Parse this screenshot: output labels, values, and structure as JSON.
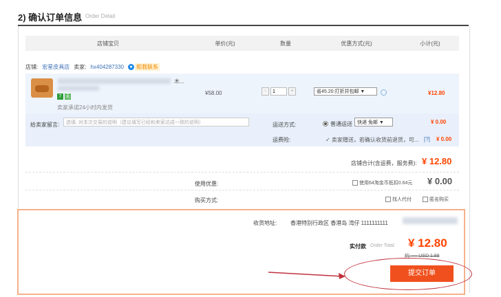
{
  "header": {
    "title": "2) 确认订单信息",
    "subtitle": "Order Detail"
  },
  "table": {
    "columns": [
      "店铺宝贝",
      "单价(元)",
      "数量",
      "优惠方式(元)",
      "小计(元)"
    ]
  },
  "store": {
    "label": "店铺:",
    "name": "宏星皮具店",
    "seller_label": "卖家:",
    "seller_id": "hx404287330",
    "wangwang": "和我联系"
  },
  "item": {
    "title_suffix": "木...",
    "tag_7": "7",
    "tag_q": "无",
    "promise": "卖家承诺24小时内发货",
    "price": "¥58.00",
    "quantity": "1",
    "qty_minus": "-",
    "qty_plus": "+",
    "promo": "省45.20:打折并包邮 ▼",
    "subtotal": "¥12.80"
  },
  "message": {
    "label": "给卖家留言:",
    "placeholder": "选填: 对本次交易的说明（建议填写已经和卖家达成一致的说明）"
  },
  "shipping": {
    "label": "运送方式:",
    "option": "普通运送",
    "select": "快递 免邮 ▼",
    "fee": "¥ 0.00"
  },
  "insurance": {
    "label": "运费险:",
    "text": "✓ 卖家赠送，若确认收货前退货，可...",
    "help": "[?]",
    "fee": "¥ 0.00"
  },
  "store_total": {
    "label": "店铺合计(含运费，服务费):",
    "value": "¥ 12.80"
  },
  "coupon": {
    "label": "使用优惠:",
    "option": "使用64淘金币抵扣0.64元",
    "value": "¥ 0.00"
  },
  "purchase": {
    "label": "购买方式:",
    "proxy": "找人代付",
    "anonymous": "匿名购买"
  },
  "address": {
    "label": "收货地址:",
    "value": "香港特别行政区 香港岛 湾仔 1111111111"
  },
  "payment": {
    "label": "实付款",
    "sub": "Order Total:",
    "amount": "¥ 12.80",
    "usd": "约 ---- USD 1.88"
  },
  "submit_label": "提交订单",
  "colors": {
    "accent": "#ff4400",
    "button": "#f0501e",
    "annotation": "#c0303c"
  }
}
